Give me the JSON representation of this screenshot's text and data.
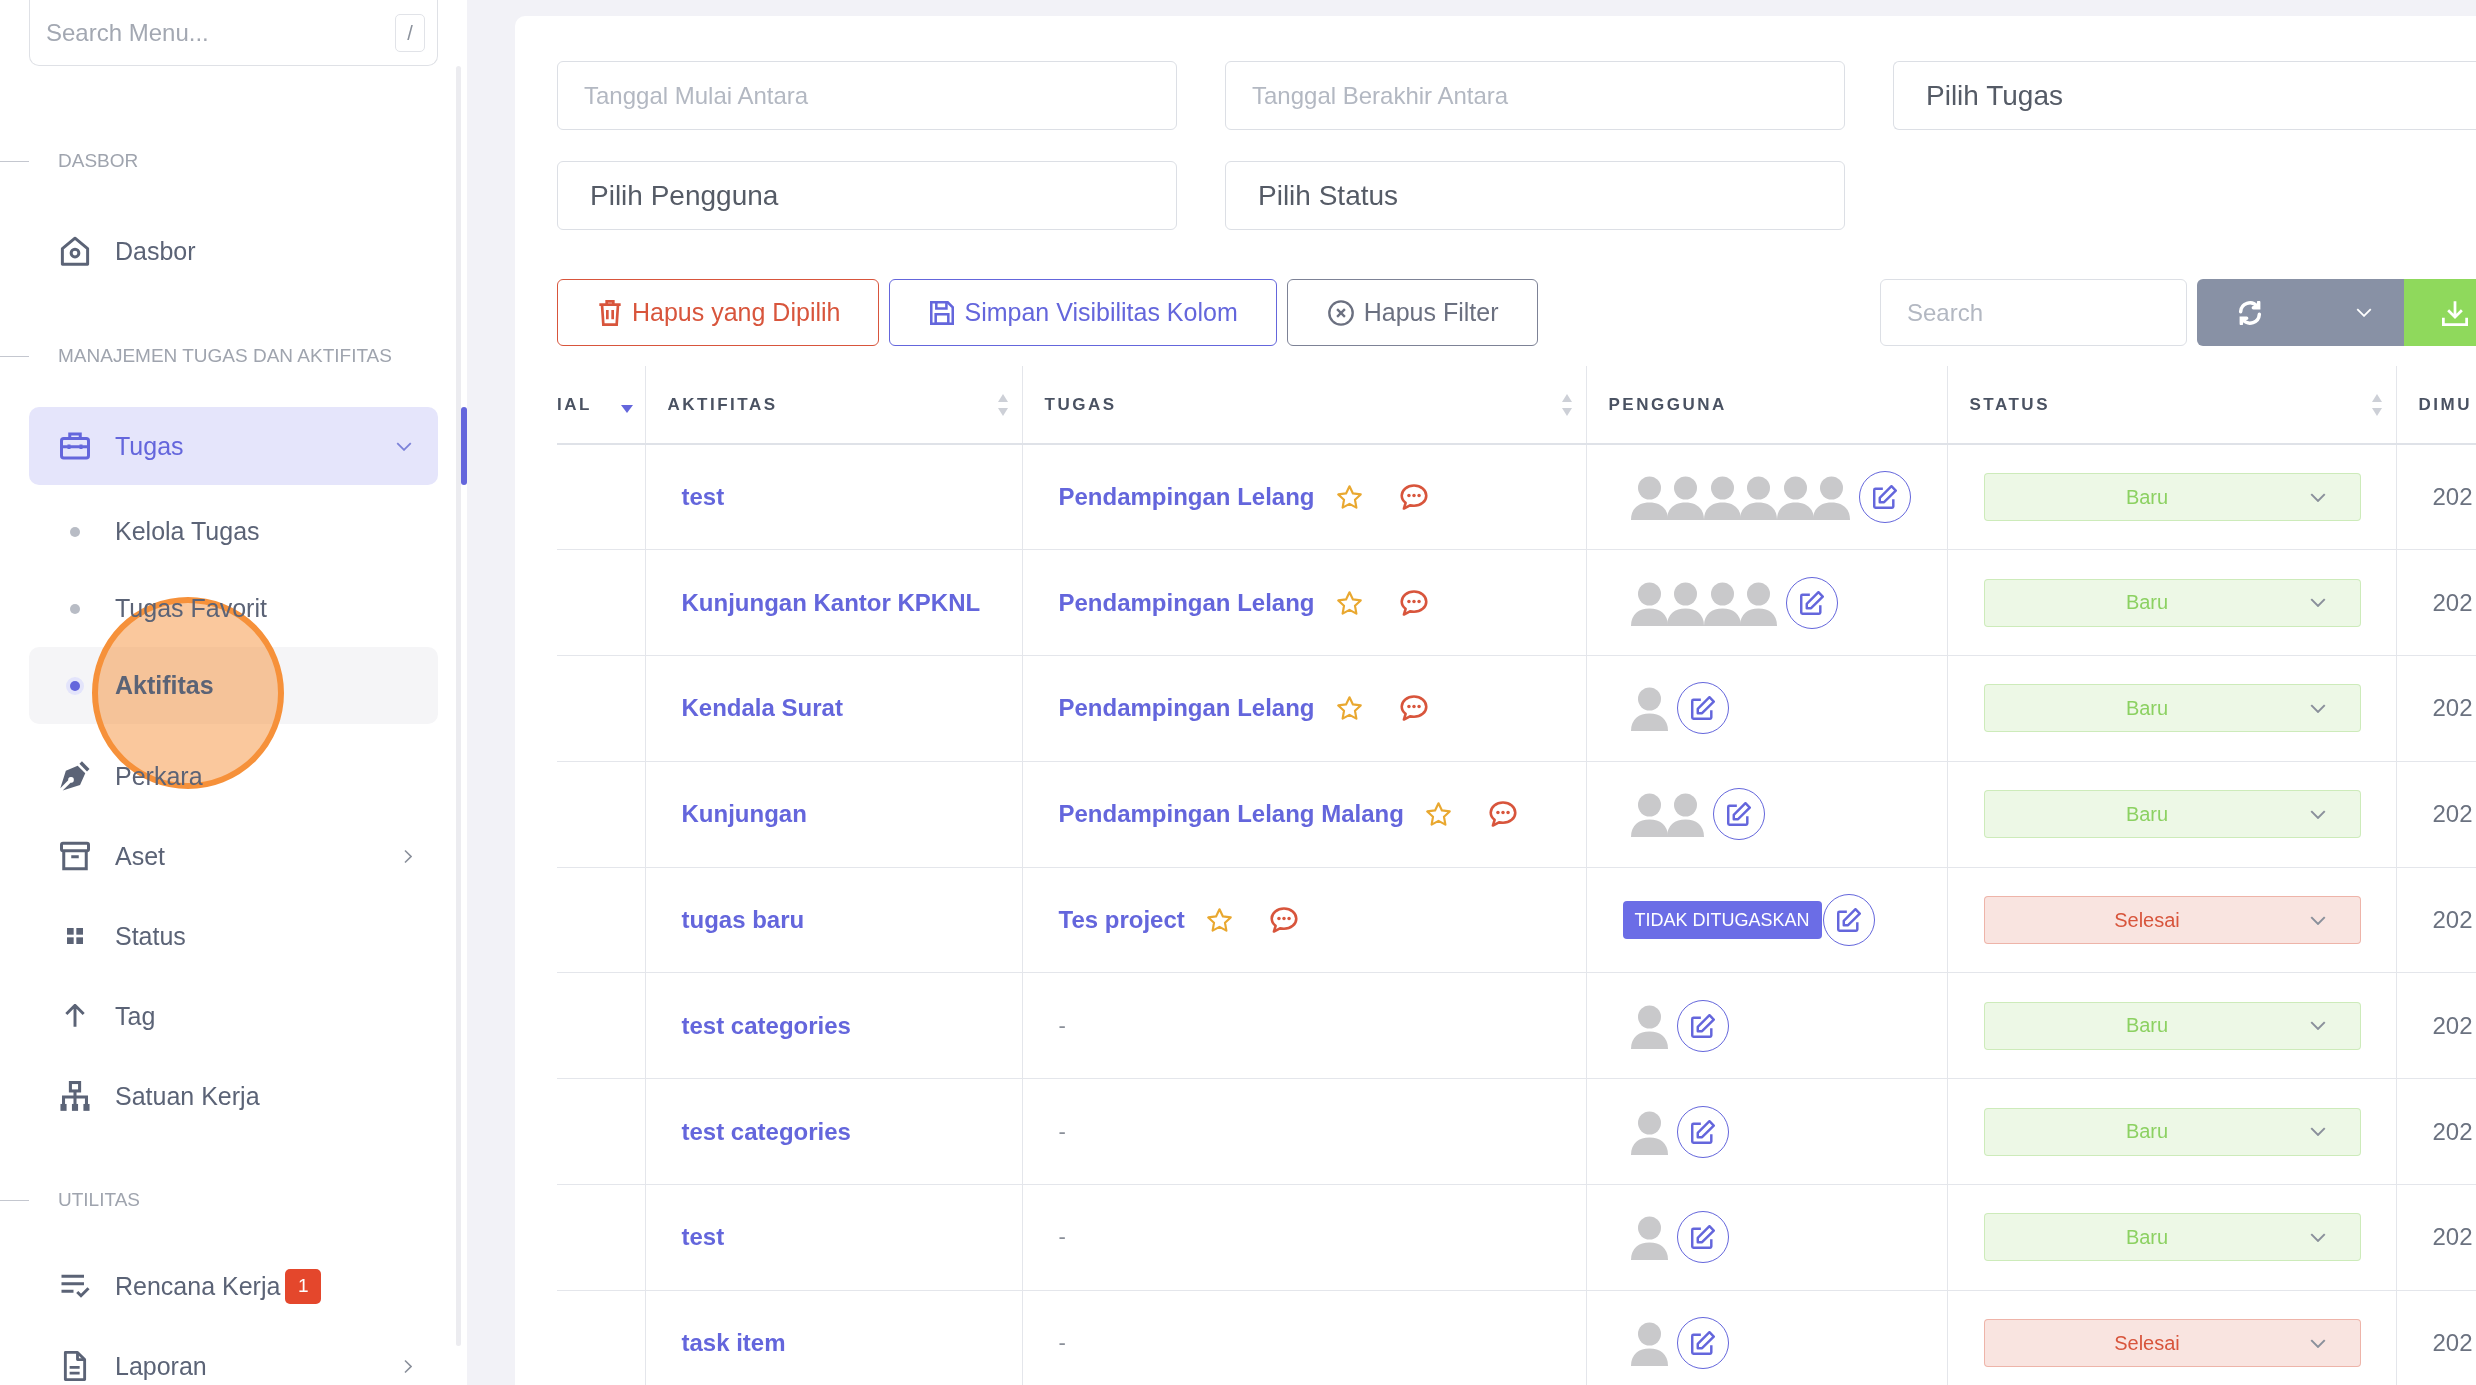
{
  "sidebar": {
    "search": {
      "placeholder": "Search Menu...",
      "shortcut": "/"
    },
    "sections": [
      {
        "title": "DASBOR",
        "items": [
          {
            "label": "Dasbor",
            "selected": false
          }
        ]
      },
      {
        "title": "MANAJEMEN TUGAS DAN AKTIFITAS",
        "items": [
          {
            "label": "Tugas",
            "selected": true,
            "expanded": true,
            "children": [
              {
                "label": "Kelola Tugas",
                "selected": false
              },
              {
                "label": "Tugas Favorit",
                "selected": false
              },
              {
                "label": "Aktifitas",
                "selected": true
              }
            ]
          },
          {
            "label": "Perkara",
            "selected": false
          },
          {
            "label": "Aset",
            "selected": false,
            "expanded": false
          },
          {
            "label": "Status",
            "selected": false
          },
          {
            "label": "Tag",
            "selected": false
          },
          {
            "label": "Satuan Kerja",
            "selected": false
          }
        ]
      },
      {
        "title": "UTILITAS",
        "items": [
          {
            "label": "Rencana Kerja",
            "selected": false,
            "badge": "1"
          },
          {
            "label": "Laporan",
            "selected": false,
            "expanded": false
          }
        ]
      }
    ]
  },
  "filters": {
    "fields": [
      {
        "kind": "date",
        "placeholder": "Tanggal Mulai Antara"
      },
      {
        "kind": "date",
        "placeholder": "Tanggal Berakhir Antara"
      },
      {
        "kind": "select",
        "placeholder": "Pilih Tugas"
      },
      {
        "kind": "select",
        "placeholder": "Pilih Pengguna"
      },
      {
        "kind": "select",
        "placeholder": "Pilih Status"
      }
    ]
  },
  "toolbar": {
    "buttons": [
      {
        "kind": "danger",
        "label": "Hapus yang Dipilih"
      },
      {
        "kind": "primary",
        "label": "Simpan Visibilitas Kolom"
      },
      {
        "kind": "secondary",
        "label": "Hapus Filter"
      }
    ],
    "search": {
      "placeholder": "Search"
    }
  },
  "table": {
    "columns": [
      {
        "label": "IAL",
        "sorted": true
      },
      {
        "label": "AKTIFITAS",
        "sorted": false
      },
      {
        "label": "TUGAS",
        "sorted": false
      },
      {
        "label": "PENGGUNA"
      },
      {
        "label": "STATUS",
        "sorted": false
      },
      {
        "label": "DIMU"
      }
    ],
    "rows": [
      {
        "aktifitas": "test",
        "tugas": {
          "kind": "link",
          "text": "Pendampingan Lelang",
          "starred": false
        },
        "pengguna": {
          "kind": "users",
          "users": [
            {
              "kind": "avatar"
            },
            {
              "kind": "avatar"
            },
            {
              "kind": "avatar"
            },
            {
              "kind": "avatar"
            },
            {
              "kind": "avatar"
            },
            {
              "kind": "avatar"
            }
          ]
        },
        "status": {
          "text": "Baru",
          "color": "#8cd162"
        },
        "column_6": "202"
      },
      {
        "aktifitas": "Kunjungan Kantor KPKNL",
        "tugas": {
          "kind": "link",
          "text": "Pendampingan Lelang",
          "starred": false
        },
        "pengguna": {
          "kind": "users",
          "users": [
            {
              "kind": "avatar"
            },
            {
              "kind": "avatar"
            },
            {
              "kind": "avatar"
            },
            {
              "kind": "avatar"
            }
          ]
        },
        "status": {
          "text": "Baru",
          "color": "#8cd162"
        },
        "column_6": "202"
      },
      {
        "aktifitas": "Kendala Surat",
        "tugas": {
          "kind": "link",
          "text": "Pendampingan Lelang",
          "starred": false
        },
        "pengguna": {
          "kind": "users",
          "users": [
            {
              "kind": "avatar"
            }
          ]
        },
        "status": {
          "text": "Baru",
          "color": "#8cd162"
        },
        "column_6": "202"
      },
      {
        "aktifitas": "Kunjungan",
        "tugas": {
          "kind": "link",
          "text": "Pendampingan Lelang Malang",
          "starred": false
        },
        "pengguna": {
          "kind": "users",
          "users": [
            {
              "kind": "avatar"
            },
            {
              "kind": "avatar"
            }
          ]
        },
        "status": {
          "text": "Baru",
          "color": "#8cd162"
        },
        "column_6": "202"
      },
      {
        "aktifitas": "tugas baru",
        "tugas": {
          "kind": "link",
          "text": "Tes project",
          "starred": false
        },
        "pengguna": {
          "kind": "unassigned",
          "badge": "TIDAK DITUGASKAN"
        },
        "status": {
          "text": "Selesai",
          "color": "#d8553c"
        },
        "column_6": "202"
      },
      {
        "aktifitas": "test categories",
        "tugas": {
          "kind": "empty",
          "text": "-"
        },
        "pengguna": {
          "kind": "users",
          "users": [
            {
              "kind": "avatar"
            }
          ]
        },
        "status": {
          "text": "Baru",
          "color": "#8cd162"
        },
        "column_6": "202"
      },
      {
        "aktifitas": "test categories",
        "tugas": {
          "kind": "empty",
          "text": "-"
        },
        "pengguna": {
          "kind": "users",
          "users": [
            {
              "kind": "avatar"
            }
          ]
        },
        "status": {
          "text": "Baru",
          "color": "#8cd162"
        },
        "column_6": "202"
      },
      {
        "aktifitas": "test",
        "tugas": {
          "kind": "empty",
          "text": "-"
        },
        "pengguna": {
          "kind": "users",
          "users": [
            {
              "kind": "avatar"
            }
          ]
        },
        "status": {
          "text": "Baru",
          "color": "#8cd162"
        },
        "column_6": "202"
      },
      {
        "aktifitas": "task item",
        "tugas": {
          "kind": "empty",
          "text": "-"
        },
        "pengguna": {
          "kind": "users",
          "users": [
            {
              "kind": "avatar"
            }
          ]
        },
        "status": {
          "text": "Selesai",
          "color": "#d8553c"
        },
        "column_6": "202"
      }
    ]
  }
}
